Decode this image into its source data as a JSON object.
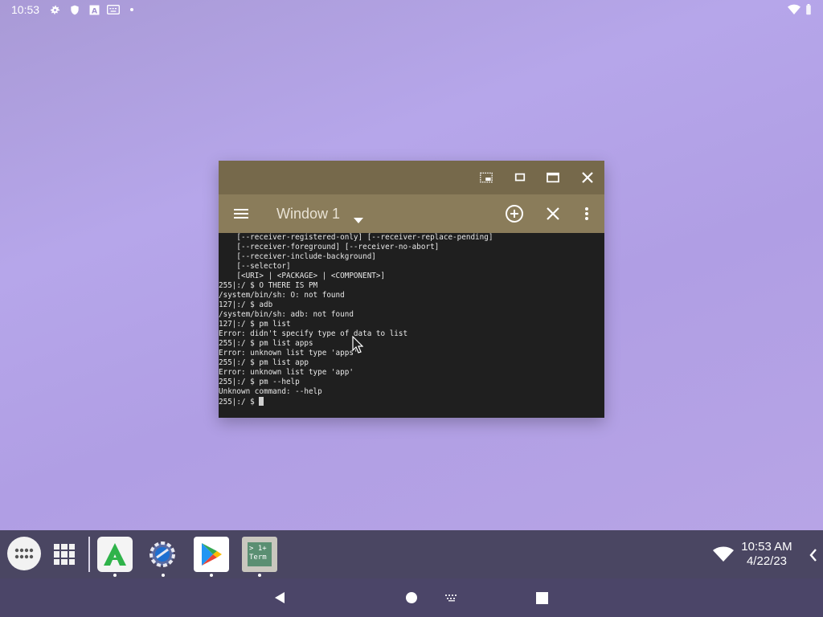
{
  "status_bar": {
    "time": "10:53",
    "icons": [
      "settings-gear-icon",
      "shield-icon",
      "font-a-icon",
      "keyboard-icon",
      "notification-dot-icon",
      "wifi-icon",
      "battery-icon"
    ]
  },
  "window": {
    "title": "Window 1",
    "caption_buttons": [
      "screenshot-icon",
      "restore-icon",
      "maximize-icon",
      "close-icon"
    ],
    "toolbar_buttons": [
      "menu-icon",
      "dropdown-arrow-icon",
      "new-window-icon",
      "close-window-icon",
      "more-options-icon"
    ],
    "console_lines": [
      "    [--receiver-registered-only] [--receiver-replace-pending]",
      "    [--receiver-foreground] [--receiver-no-abort]",
      "    [--receiver-include-background]",
      "    [--selector]",
      "    [<URI> | <PACKAGE> | <COMPONENT>]",
      "255|:/ $ O THERE IS PM",
      "/system/bin/sh: O: not found",
      "127|:/ $ adb",
      "/system/bin/sh: adb: not found",
      "127|:/ $ pm list",
      "Error: didn't specify type of data to list",
      "255|:/ $ pm list apps",
      "Error: unknown list type 'apps'",
      "255|:/ $ pm list app",
      "Error: unknown list type 'app'",
      "255|:/ $ pm --help",
      "Unknown command: --help"
    ],
    "prompt": "255|:/ $ "
  },
  "taskbar": {
    "apps": [
      "app-drawer-icon",
      "window-grid-icon",
      "apkpure-icon",
      "settings-app-icon",
      "play-store-icon",
      "terminal-app-icon"
    ],
    "terminal_icon_text": "> 1+",
    "terminal_icon_label": "Term",
    "clock_time": "10:53 AM",
    "clock_date": "4/22/23"
  },
  "navbar": {
    "buttons": [
      "back-icon",
      "home-icon",
      "keyboard-switch-icon",
      "recents-icon"
    ]
  },
  "colors": {
    "caption": "#76694b",
    "toolbar": "#8a7c5a",
    "console_bg": "#1f1f1f",
    "taskbar": "#4a4662"
  }
}
